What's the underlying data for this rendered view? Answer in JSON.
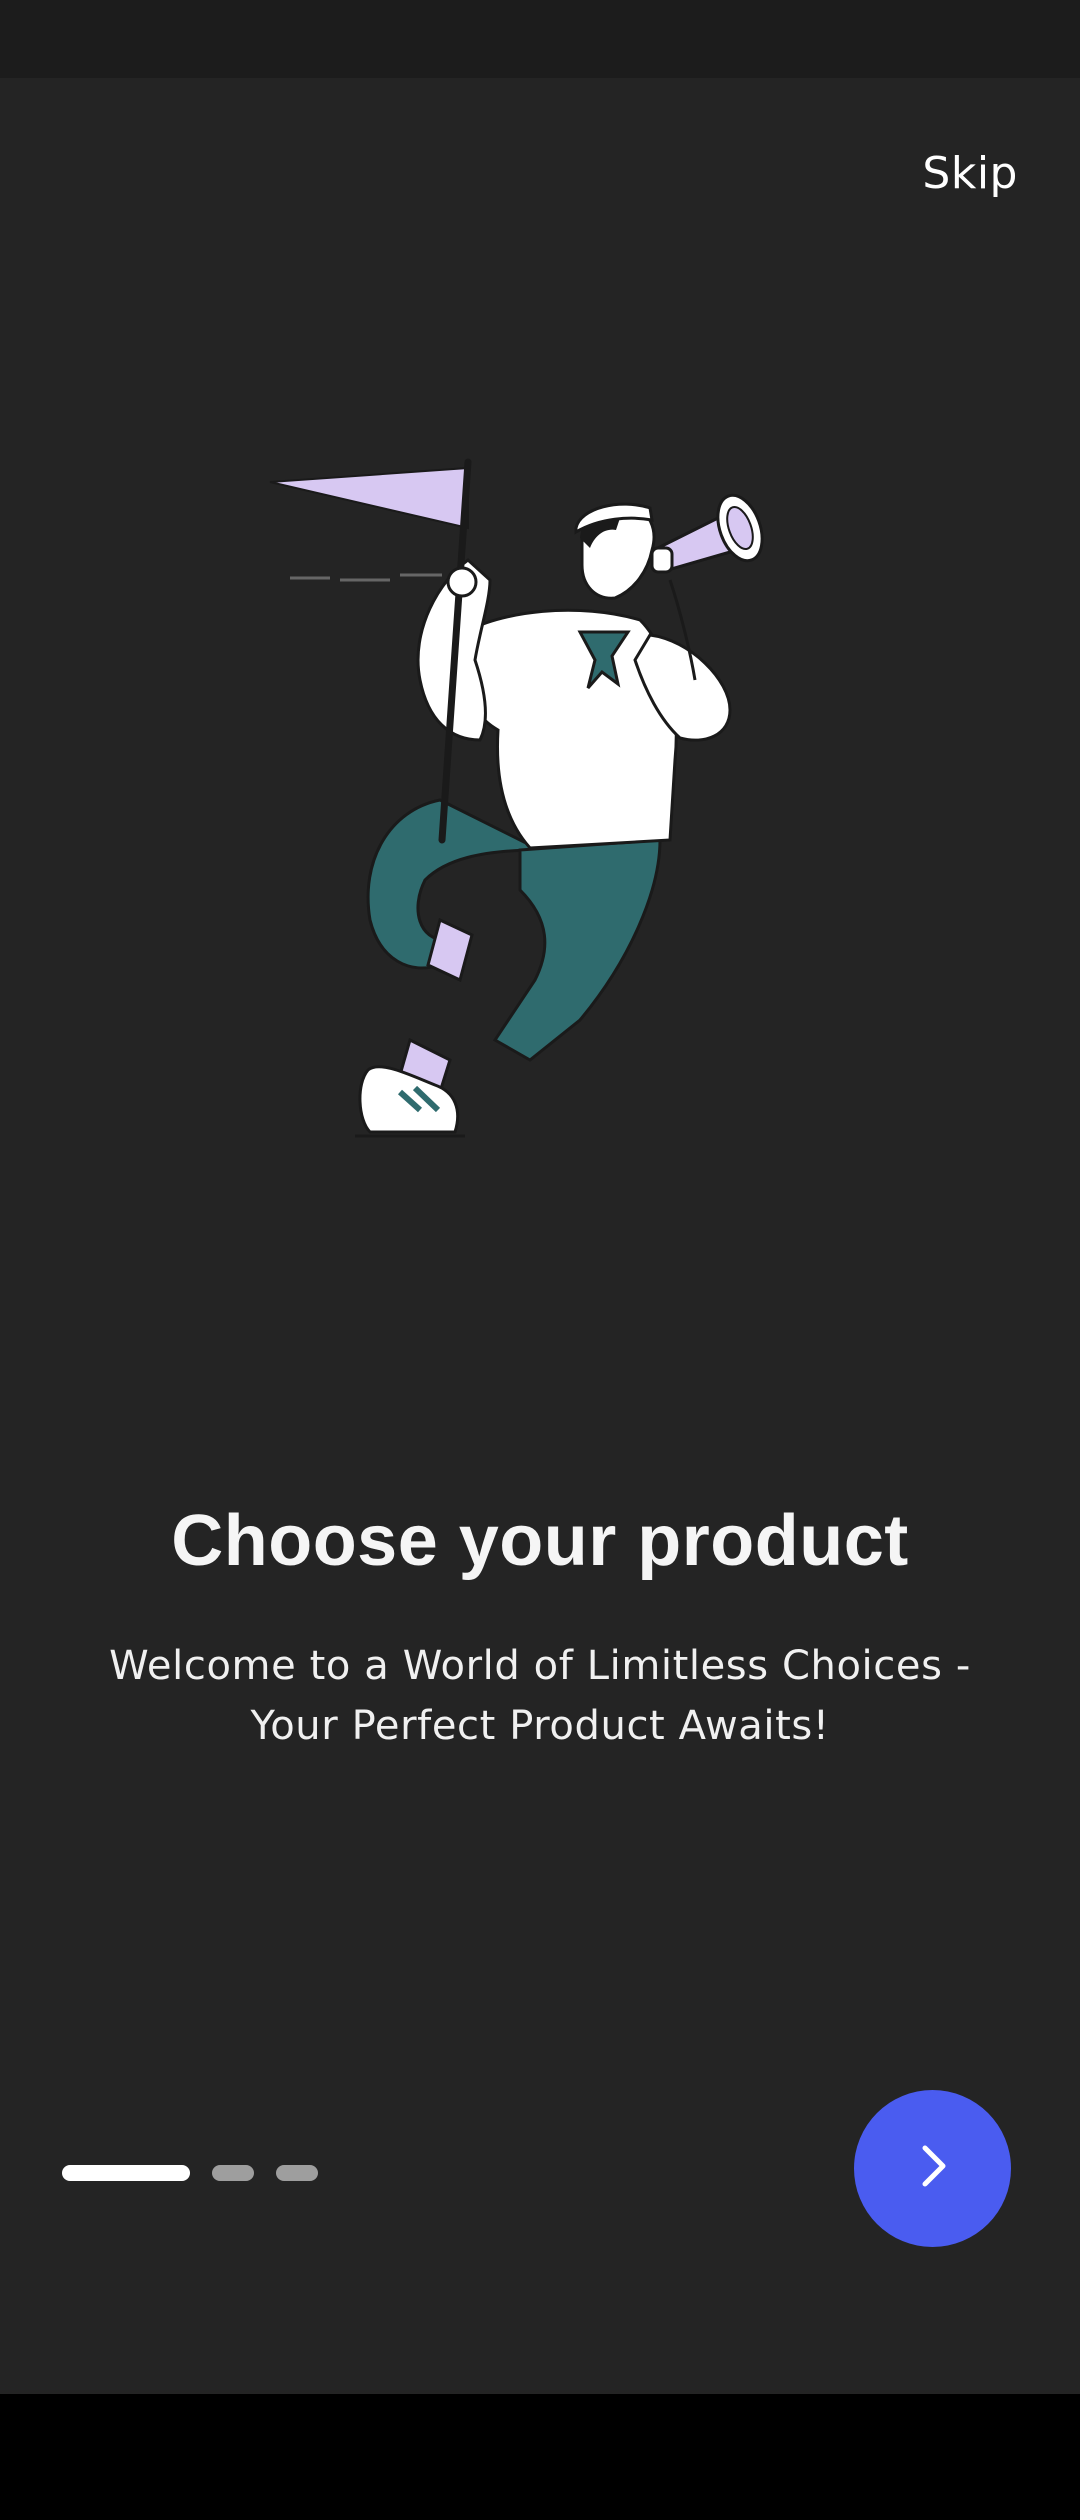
{
  "onboarding": {
    "skip_label": "Skip",
    "title": "Choose your product",
    "subtitle": "Welcome to a World of Limitless Choices - Your Perfect Product Awaits!",
    "page_indicator": {
      "current": 1,
      "total": 3
    },
    "next_icon": "chevron-right-icon",
    "illustration": "sailor-with-flag-and-telescope"
  },
  "colors": {
    "background": "#242424",
    "accent": "#4a5cf0",
    "indicator_active": "#ffffff",
    "indicator_inactive": "#9e9e9e",
    "illustration_teal": "#2f6b6e",
    "illustration_lavender": "#d7c8f2"
  }
}
